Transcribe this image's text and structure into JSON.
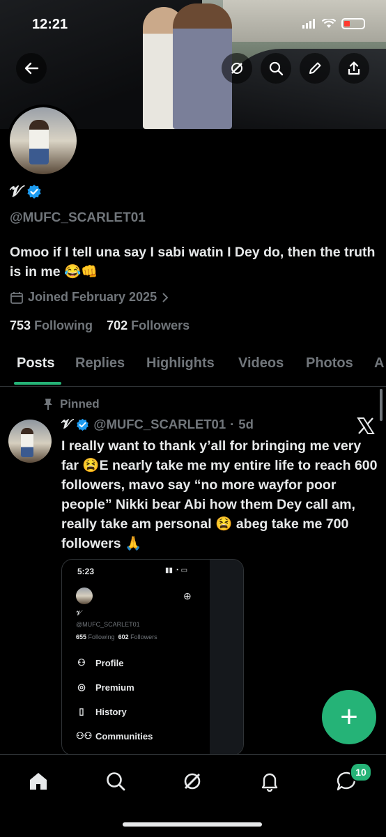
{
  "status_bar": {
    "time": "12:21"
  },
  "banner": {
    "icons": [
      "back-arrow-icon",
      "grok-icon",
      "search-icon",
      "edit-icon",
      "share-icon"
    ]
  },
  "profile": {
    "name": "𝓥",
    "verified": true,
    "handle": "@MUFC_SCARLET01",
    "bio": "Omoo if I tell una say I sabi watin I Dey do, then the truth is in me 😂👊",
    "joined": "Joined February 2025",
    "following_count": "753",
    "following_label": "Following",
    "followers_count": "702",
    "followers_label": "Followers"
  },
  "tabs": [
    "Posts",
    "Replies",
    "Highlights",
    "Videos",
    "Photos",
    "A"
  ],
  "active_tab": "Posts",
  "pinned_post": {
    "pinned_label": "Pinned",
    "author_name": "𝓥",
    "author_handle": "@MUFC_SCARLET01",
    "separator": "·",
    "time": "5d",
    "text": "I really want to thank y’all for bringing me very far 😫E nearly take me my entire life to reach 600 followers, mavo say “no more wayfor poor people” Nikki bear Abi how them Dey call am, really take am personal 😫 abeg take me 700 followers 🙏",
    "media": {
      "time": "5:23",
      "name": "𝓥",
      "handle": "@MUFC_SCARLET01",
      "following_count": "655",
      "following_label": "Following",
      "followers_count": "602",
      "followers_label": "Followers",
      "menu": [
        "Profile",
        "Premium",
        "History",
        "Communities"
      ]
    }
  },
  "fab": {
    "label": "+"
  },
  "bottom_nav": {
    "items": [
      "home-icon",
      "search-icon",
      "grok-icon",
      "notifications-icon",
      "messages-icon"
    ],
    "messages_badge": "10"
  },
  "colors": {
    "accent": "#25b377",
    "verified": "#1d9bf0",
    "muted": "#71767b",
    "text": "#e7e9ea"
  }
}
